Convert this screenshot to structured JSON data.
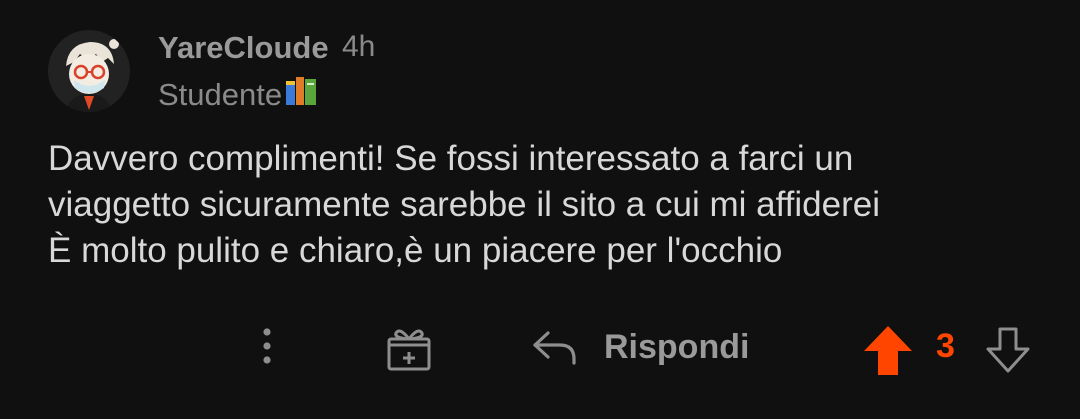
{
  "comment": {
    "author": "YareCloude",
    "timestamp": "4h",
    "flair": "Studente",
    "flair_icon": "books-icon",
    "body_lines": [
      "Davvero complimenti! Se fossi interessato a farci un",
      "viaggetto sicuramente sarebbe il sito a cui mi affiderei",
      "È molto pulito e chiaro,è un piacere per l'occhio"
    ]
  },
  "actions": {
    "more_icon": "more-vertical-icon",
    "gift_icon": "gift-icon",
    "reply_icon": "reply-arrow-icon",
    "reply_label": "Rispondi",
    "upvote_icon": "upvote-arrow-icon",
    "vote_count": "3",
    "downvote_icon": "downvote-arrow-icon"
  },
  "colors": {
    "background": "#101010",
    "upvote_active": "#ff4500",
    "muted_text": "#9a9a9a",
    "body_text": "#d8d8d8"
  }
}
